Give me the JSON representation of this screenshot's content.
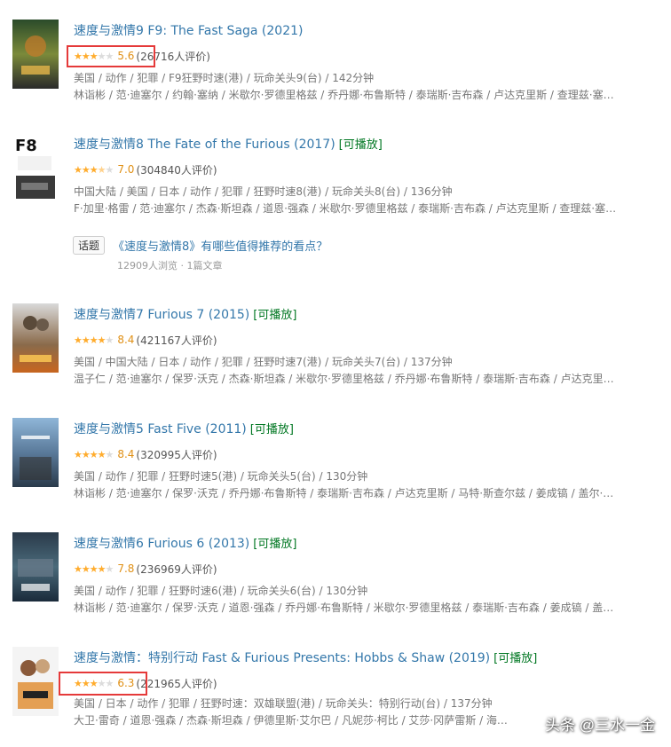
{
  "colors": {
    "link": "#3377aa",
    "playable": "#007722",
    "star": "#ffac2d",
    "score": "#e09015",
    "highlight": "#e53a3a"
  },
  "items": [
    {
      "title": "速度与激情9 F9: The Fast Saga (2021)",
      "playable": "",
      "rating_stars": 3,
      "score": "5.6",
      "count": "(26716人评价)",
      "meta1": "美国 / 动作 / 犯罪 / F9狂野时速(港) / 玩命关头9(台) / 142分钟",
      "meta2": "林诣彬 / 范·迪塞尔 / 约翰·塞纳 / 米歇尔·罗德里格兹 / 乔丹娜·布鲁斯特 / 泰瑞斯·吉布森 / 卢达克里斯 / 查理兹·塞…"
    },
    {
      "title": "速度与激情8 The Fate of the Furious (2017)",
      "playable": "[可播放]",
      "rating_stars": 3.5,
      "score": "7.0",
      "count": "(304840人评价)",
      "meta1": "中国大陆 / 美国 / 日本 / 动作 / 犯罪 / 狂野时速8(港) / 玩命关头8(台) / 136分钟",
      "meta2": "F·加里·格雷 / 范·迪塞尔 / 杰森·斯坦森 / 道恩·强森 / 米歇尔·罗德里格兹 / 泰瑞斯·吉布森 / 卢达克里斯 / 查理兹·塞…"
    },
    {
      "title": "速度与激情7 Furious 7 (2015)",
      "playable": "[可播放]",
      "rating_stars": 4,
      "score": "8.4",
      "count": "(421167人评价)",
      "meta1": "美国 / 中国大陆 / 日本 / 动作 / 犯罪 / 狂野时速7(港) / 玩命关头7(台) / 137分钟",
      "meta2": "温子仁 / 范·迪塞尔 / 保罗·沃克 / 杰森·斯坦森 / 米歇尔·罗德里格兹 / 乔丹娜·布鲁斯特 / 泰瑞斯·吉布森 / 卢达克里…"
    },
    {
      "title": "速度与激情5 Fast Five (2011)",
      "playable": "[可播放]",
      "rating_stars": 4,
      "score": "8.4",
      "count": "(320995人评价)",
      "meta1": "美国 / 动作 / 犯罪 / 狂野时速5(港) / 玩命关头5(台) / 130分钟",
      "meta2": "林诣彬 / 范·迪塞尔 / 保罗·沃克 / 乔丹娜·布鲁斯特 / 泰瑞斯·吉布森 / 卢达克里斯 / 马特·斯查尔兹 / 姜成镐 / 盖尔·…"
    },
    {
      "title": "速度与激情6 Furious 6 (2013)",
      "playable": "[可播放]",
      "rating_stars": 4,
      "score": "7.8",
      "count": "(236969人评价)",
      "meta1": "美国 / 动作 / 犯罪 / 狂野时速6(港) / 玩命关头6(台) / 130分钟",
      "meta2": "林诣彬 / 范·迪塞尔 / 保罗·沃克 / 道恩·强森 / 乔丹娜·布鲁斯特 / 米歇尔·罗德里格兹 / 泰瑞斯·吉布森 / 姜成镐 / 盖…"
    },
    {
      "title": "速度与激情：特别行动 Fast & Furious Presents: Hobbs & Shaw (2019)",
      "playable": "[可播放]",
      "rating_stars": 3,
      "score": "6.3",
      "count": "(221965人评价)",
      "meta1": "美国 / 日本 / 动作 / 犯罪 / 狂野时速：双雄联盟(港) / 玩命关头：特别行动(台) / 137分钟",
      "meta2": "大卫·雷奇 / 道恩·强森 / 杰森·斯坦森 / 伊德里斯·艾尔巴 / 凡妮莎·柯比 / 艾莎·冈萨雷斯 / 海…"
    }
  ],
  "topic": {
    "tag": "话题",
    "link": "《速度与激情8》有哪些值得推荐的看点？",
    "stats": "12909人浏览 · 1篇文章"
  },
  "watermark": "头条 @三水一金",
  "icons": [
    "poster-image",
    "star-icon"
  ]
}
